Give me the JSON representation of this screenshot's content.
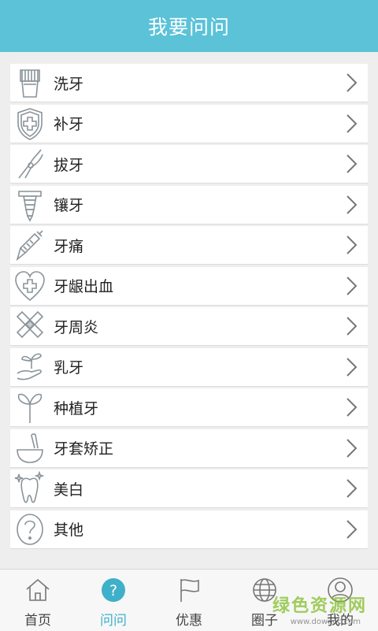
{
  "header": {
    "title": "我要问问"
  },
  "menu": [
    {
      "label": "洗牙",
      "icon": "toothbrush-icon"
    },
    {
      "label": "补牙",
      "icon": "shield-cross-icon"
    },
    {
      "label": "拔牙",
      "icon": "pliers-icon"
    },
    {
      "label": "镶牙",
      "icon": "implant-icon"
    },
    {
      "label": "牙痛",
      "icon": "syringe-icon"
    },
    {
      "label": "牙龈出血",
      "icon": "heart-cross-icon"
    },
    {
      "label": "牙周炎",
      "icon": "bandage-icon"
    },
    {
      "label": "乳牙",
      "icon": "hand-sprout-icon"
    },
    {
      "label": "种植牙",
      "icon": "sprout-icon"
    },
    {
      "label": "牙套矫正",
      "icon": "mortar-icon"
    },
    {
      "label": "美白",
      "icon": "sparkle-tooth-icon"
    },
    {
      "label": "其他",
      "icon": "question-circle-icon"
    }
  ],
  "tabs": [
    {
      "label": "首页",
      "icon": "home-icon",
      "active": false
    },
    {
      "label": "问问",
      "icon": "question-badge-icon",
      "active": true
    },
    {
      "label": "优惠",
      "icon": "flag-icon",
      "active": false
    },
    {
      "label": "圈子",
      "icon": "globe-icon",
      "active": false
    },
    {
      "label": "我的",
      "icon": "user-icon",
      "active": false
    }
  ],
  "watermark": {
    "text": "绿色资源网",
    "sub": "www.downcc.com"
  },
  "colors": {
    "header": "#5bc2d8",
    "accent": "#3fb0c9",
    "icon_stroke": "#8a9499"
  }
}
